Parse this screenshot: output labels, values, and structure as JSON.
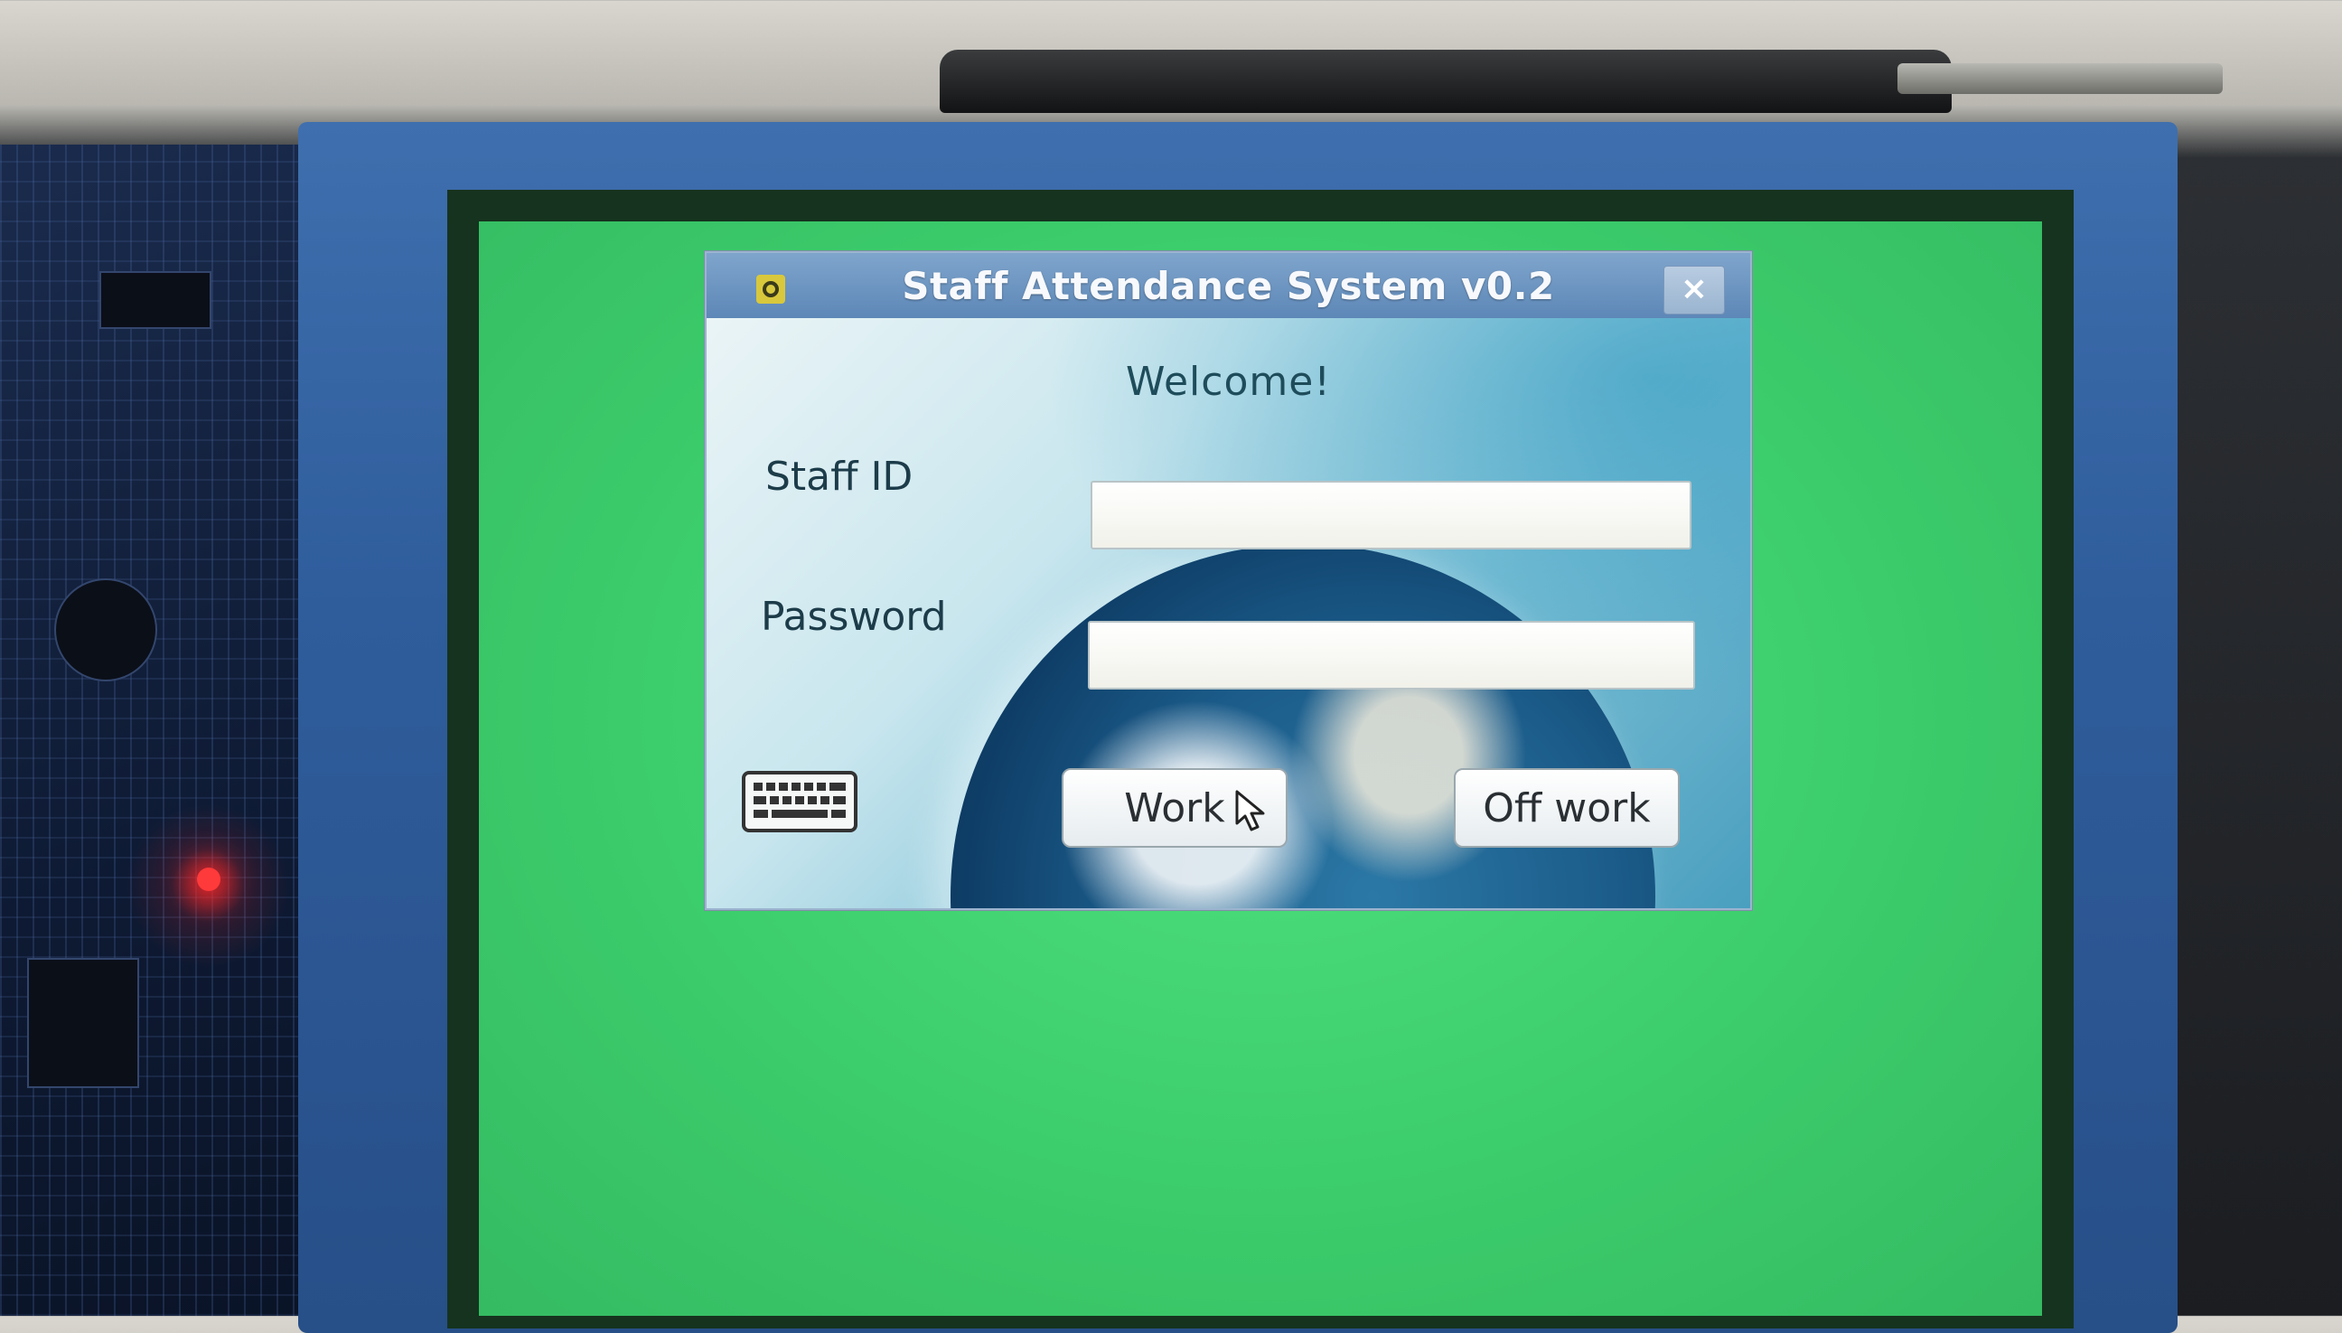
{
  "window": {
    "title": "Staff Attendance System v0.2",
    "close_label": "×"
  },
  "form": {
    "welcome": "Welcome!",
    "staff_id_label": "Staff ID",
    "staff_id_value": "",
    "password_label": "Password",
    "password_value": ""
  },
  "buttons": {
    "work_label": "Work",
    "off_work_label": "Off work"
  },
  "icons": {
    "app": "qt-app-icon",
    "keyboard": "keyboard-icon",
    "cursor": "mouse-pointer-icon"
  },
  "colors": {
    "screen": "#3ccd6c",
    "titlebar": "#6a92c0",
    "bezel": "#2f5d9c"
  }
}
